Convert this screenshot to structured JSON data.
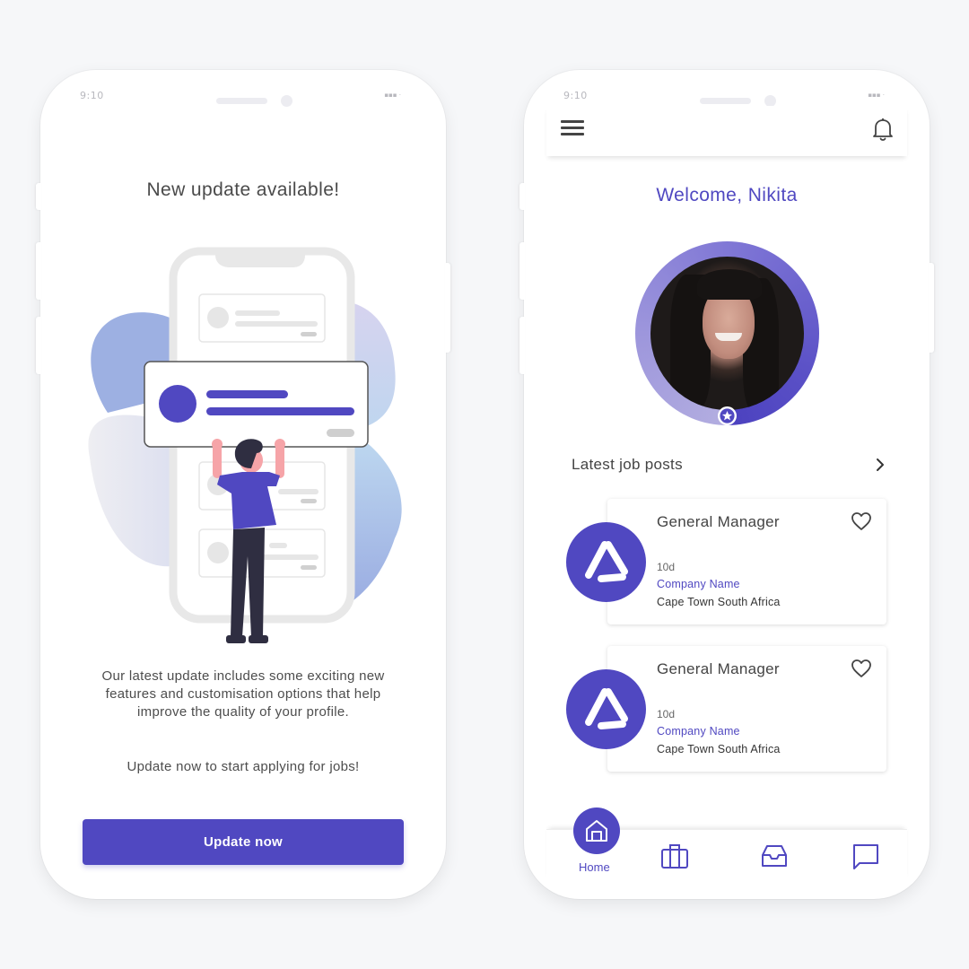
{
  "colors": {
    "brand": "#5048c1",
    "background": "#f6f7f9",
    "text_dark": "#444444"
  },
  "left_screen": {
    "status_time": "9:10",
    "title": "New update available!",
    "body": "Our latest update includes some exciting new features and customisation options that help improve the quality of your profile.",
    "cta_text": "Update now to start applying for jobs!",
    "button_label": "Update now",
    "illustration": "person-holding-notification-card-illustration"
  },
  "right_screen": {
    "status_time": "9:10",
    "header": {
      "menu_icon": "hamburger-menu-icon",
      "notification_icon": "bell-icon"
    },
    "welcome": "Welcome, Nikita",
    "profile": {
      "badge_icon": "star-icon",
      "photo": "profile-photo"
    },
    "section_title": "Latest job posts",
    "jobs": [
      {
        "title": "General Manager",
        "age": "10d",
        "company": "Company Name",
        "location": "Cape Town South Africa"
      },
      {
        "title": "General Manager",
        "age": "10d",
        "company": "Company Name",
        "location": "Cape Town South Africa"
      }
    ],
    "nav": [
      {
        "label": "Home",
        "icon": "home-icon",
        "active": true
      },
      {
        "label": "",
        "icon": "briefcase-icon",
        "active": false
      },
      {
        "label": "",
        "icon": "inbox-icon",
        "active": false
      },
      {
        "label": "",
        "icon": "chat-icon",
        "active": false
      }
    ]
  }
}
